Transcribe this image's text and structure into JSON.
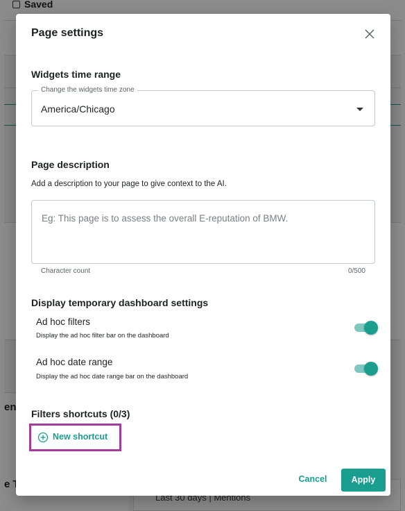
{
  "background": {
    "saved_label": "Saved",
    "text_fragment_1": "en",
    "text_fragment_2": "e T",
    "text_fragment_3": "Last 30 days | Mentions"
  },
  "modal": {
    "title": "Page settings",
    "close_icon": "close-icon"
  },
  "time_range": {
    "title": "Widgets time range",
    "field_label": "Change the widgets time zone",
    "value": "America/Chicago"
  },
  "description": {
    "title": "Page description",
    "help_text": "Add a description to your page to give context to the AI.",
    "placeholder": "Eg: This page is to assess the overall E-reputation of BMW.",
    "value": "",
    "char_count_label": "Character count",
    "char_count": "0/500"
  },
  "dashboard_settings": {
    "title": "Display temporary dashboard settings",
    "toggles": [
      {
        "label": "Ad hoc filters",
        "description": "Display the ad hoc filter bar on the dashboard",
        "enabled": true
      },
      {
        "label": "Ad hoc date range",
        "description": "Display the ad hoc date range bar on the dashboard",
        "enabled": true
      }
    ]
  },
  "filters_shortcuts": {
    "title": "Filters shortcuts (0/3)",
    "new_shortcut_label": "New shortcut",
    "icon": "plus-circle-icon"
  },
  "footer": {
    "cancel_label": "Cancel",
    "apply_label": "Apply"
  },
  "colors": {
    "accent": "#1a9e8f",
    "highlight": "#a43c9c"
  }
}
